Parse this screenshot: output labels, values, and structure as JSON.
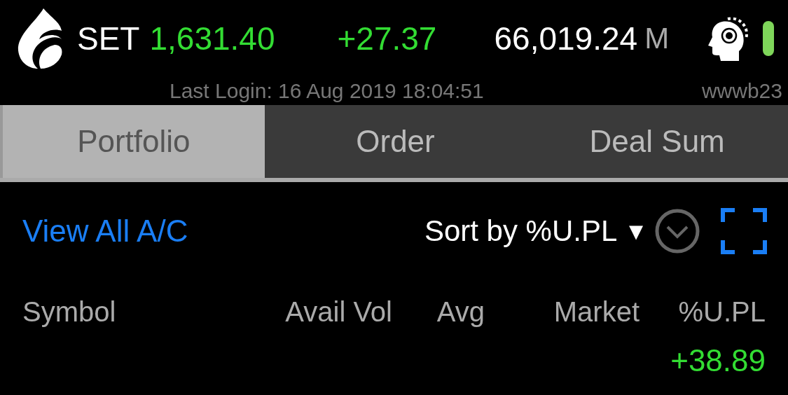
{
  "header": {
    "exchange": "SET",
    "index": "1,631.40",
    "change": "+27.37",
    "color": "#33dd33",
    "value": "66,019.24",
    "unit": "M"
  },
  "login": {
    "last_login": "Last Login: 16 Aug 2019 18:04:51",
    "user": "wwwb23"
  },
  "tabs": [
    {
      "label": "Portfolio",
      "selected": true
    },
    {
      "label": "Order",
      "selected": false
    },
    {
      "label": "Deal Sum",
      "selected": false
    }
  ],
  "toolbar": {
    "link": "View All A/C",
    "sort": "Sort by %U.PL",
    "sort_caret": "▼"
  },
  "columns": [
    "Symbol",
    "Avail Vol",
    "Avg",
    "Market",
    "%U.PL"
  ],
  "rows": [
    {
      "u_pl": "+38.89",
      "color": "#33dd33"
    }
  ]
}
